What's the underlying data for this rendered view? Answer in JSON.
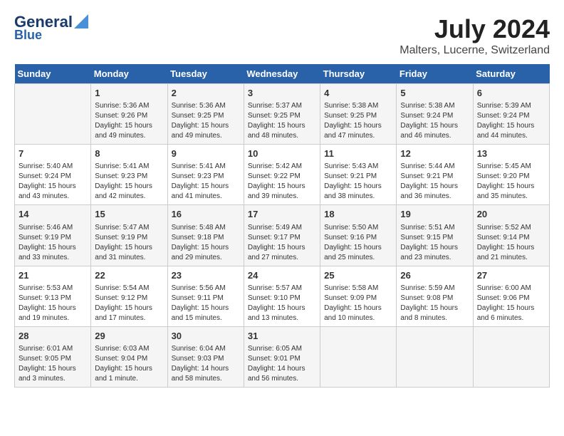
{
  "logo": {
    "line1": "General",
    "line2": "Blue"
  },
  "title": "July 2024",
  "subtitle": "Malters, Lucerne, Switzerland",
  "headers": [
    "Sunday",
    "Monday",
    "Tuesday",
    "Wednesday",
    "Thursday",
    "Friday",
    "Saturday"
  ],
  "weeks": [
    [
      {
        "day": "",
        "info": ""
      },
      {
        "day": "1",
        "info": "Sunrise: 5:36 AM\nSunset: 9:26 PM\nDaylight: 15 hours\nand 49 minutes."
      },
      {
        "day": "2",
        "info": "Sunrise: 5:36 AM\nSunset: 9:25 PM\nDaylight: 15 hours\nand 49 minutes."
      },
      {
        "day": "3",
        "info": "Sunrise: 5:37 AM\nSunset: 9:25 PM\nDaylight: 15 hours\nand 48 minutes."
      },
      {
        "day": "4",
        "info": "Sunrise: 5:38 AM\nSunset: 9:25 PM\nDaylight: 15 hours\nand 47 minutes."
      },
      {
        "day": "5",
        "info": "Sunrise: 5:38 AM\nSunset: 9:24 PM\nDaylight: 15 hours\nand 46 minutes."
      },
      {
        "day": "6",
        "info": "Sunrise: 5:39 AM\nSunset: 9:24 PM\nDaylight: 15 hours\nand 44 minutes."
      }
    ],
    [
      {
        "day": "7",
        "info": "Sunrise: 5:40 AM\nSunset: 9:24 PM\nDaylight: 15 hours\nand 43 minutes."
      },
      {
        "day": "8",
        "info": "Sunrise: 5:41 AM\nSunset: 9:23 PM\nDaylight: 15 hours\nand 42 minutes."
      },
      {
        "day": "9",
        "info": "Sunrise: 5:41 AM\nSunset: 9:23 PM\nDaylight: 15 hours\nand 41 minutes."
      },
      {
        "day": "10",
        "info": "Sunrise: 5:42 AM\nSunset: 9:22 PM\nDaylight: 15 hours\nand 39 minutes."
      },
      {
        "day": "11",
        "info": "Sunrise: 5:43 AM\nSunset: 9:21 PM\nDaylight: 15 hours\nand 38 minutes."
      },
      {
        "day": "12",
        "info": "Sunrise: 5:44 AM\nSunset: 9:21 PM\nDaylight: 15 hours\nand 36 minutes."
      },
      {
        "day": "13",
        "info": "Sunrise: 5:45 AM\nSunset: 9:20 PM\nDaylight: 15 hours\nand 35 minutes."
      }
    ],
    [
      {
        "day": "14",
        "info": "Sunrise: 5:46 AM\nSunset: 9:19 PM\nDaylight: 15 hours\nand 33 minutes."
      },
      {
        "day": "15",
        "info": "Sunrise: 5:47 AM\nSunset: 9:19 PM\nDaylight: 15 hours\nand 31 minutes."
      },
      {
        "day": "16",
        "info": "Sunrise: 5:48 AM\nSunset: 9:18 PM\nDaylight: 15 hours\nand 29 minutes."
      },
      {
        "day": "17",
        "info": "Sunrise: 5:49 AM\nSunset: 9:17 PM\nDaylight: 15 hours\nand 27 minutes."
      },
      {
        "day": "18",
        "info": "Sunrise: 5:50 AM\nSunset: 9:16 PM\nDaylight: 15 hours\nand 25 minutes."
      },
      {
        "day": "19",
        "info": "Sunrise: 5:51 AM\nSunset: 9:15 PM\nDaylight: 15 hours\nand 23 minutes."
      },
      {
        "day": "20",
        "info": "Sunrise: 5:52 AM\nSunset: 9:14 PM\nDaylight: 15 hours\nand 21 minutes."
      }
    ],
    [
      {
        "day": "21",
        "info": "Sunrise: 5:53 AM\nSunset: 9:13 PM\nDaylight: 15 hours\nand 19 minutes."
      },
      {
        "day": "22",
        "info": "Sunrise: 5:54 AM\nSunset: 9:12 PM\nDaylight: 15 hours\nand 17 minutes."
      },
      {
        "day": "23",
        "info": "Sunrise: 5:56 AM\nSunset: 9:11 PM\nDaylight: 15 hours\nand 15 minutes."
      },
      {
        "day": "24",
        "info": "Sunrise: 5:57 AM\nSunset: 9:10 PM\nDaylight: 15 hours\nand 13 minutes."
      },
      {
        "day": "25",
        "info": "Sunrise: 5:58 AM\nSunset: 9:09 PM\nDaylight: 15 hours\nand 10 minutes."
      },
      {
        "day": "26",
        "info": "Sunrise: 5:59 AM\nSunset: 9:08 PM\nDaylight: 15 hours\nand 8 minutes."
      },
      {
        "day": "27",
        "info": "Sunrise: 6:00 AM\nSunset: 9:06 PM\nDaylight: 15 hours\nand 6 minutes."
      }
    ],
    [
      {
        "day": "28",
        "info": "Sunrise: 6:01 AM\nSunset: 9:05 PM\nDaylight: 15 hours\nand 3 minutes."
      },
      {
        "day": "29",
        "info": "Sunrise: 6:03 AM\nSunset: 9:04 PM\nDaylight: 15 hours\nand 1 minute."
      },
      {
        "day": "30",
        "info": "Sunrise: 6:04 AM\nSunset: 9:03 PM\nDaylight: 14 hours\nand 58 minutes."
      },
      {
        "day": "31",
        "info": "Sunrise: 6:05 AM\nSunset: 9:01 PM\nDaylight: 14 hours\nand 56 minutes."
      },
      {
        "day": "",
        "info": ""
      },
      {
        "day": "",
        "info": ""
      },
      {
        "day": "",
        "info": ""
      }
    ]
  ]
}
